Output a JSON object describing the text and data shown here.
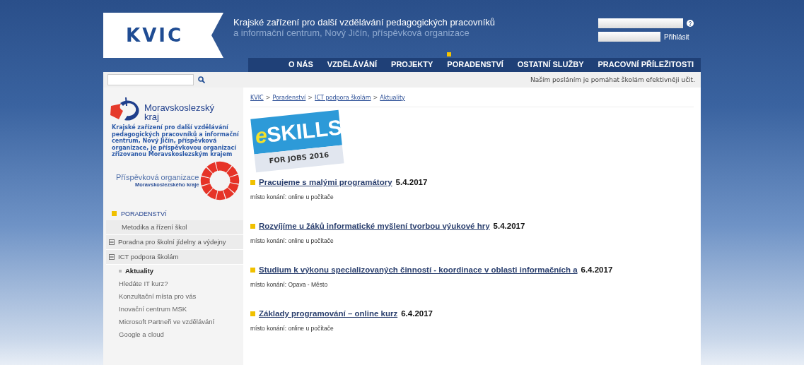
{
  "header": {
    "logo": "KVIC",
    "title_line1": "Krajské zařízení pro další vzdělávání pedagogických pracovníků",
    "title_line2": "a informační centrum, Nový Jičín, příspěvková organizace",
    "login_button": "Přihlásit"
  },
  "nav": [
    {
      "label": "O NÁS",
      "selected": false
    },
    {
      "label": "VZDĚLÁVÁNÍ",
      "selected": false
    },
    {
      "label": "PROJEKTY",
      "selected": false
    },
    {
      "label": "PORADENSTVÍ",
      "selected": true
    },
    {
      "label": "OSTATNÍ SLUŽBY",
      "selected": false
    },
    {
      "label": "PRACOVNÍ PŘÍLEŽITOSTI",
      "selected": false
    }
  ],
  "slogan": "Naším posláním je pomáhat školám efektivněji učit.",
  "sidebar": {
    "region_name_1": "Moravskoslezský",
    "region_name_2": "kraj",
    "description": "Krajské zařízení pro další vzdělávání pedagogických pracovníků a informační centrum, Nový Jičín, příspěvková organizace, je příspěvkovou organizací zřizovanou Moravskoslezským krajem",
    "badge_title": "Příspěvková organizace",
    "badge_subtitle": "Moravskoslezského kraje",
    "menu_title": "PORADENSTVÍ",
    "menu": [
      {
        "label": "Metodika a řízení škol",
        "kind": "plain"
      },
      {
        "label": "Poradna pro školní jídelny a výdejny",
        "kind": "expandable"
      },
      {
        "label": "ICT podpora školám",
        "kind": "expandable",
        "children": [
          {
            "label": "Aktuality",
            "selected": true
          },
          {
            "label": "Hledáte IT kurz?",
            "selected": false
          },
          {
            "label": "Konzultační místa pro vás",
            "selected": false
          },
          {
            "label": "Inovační centrum MSK",
            "selected": false
          },
          {
            "label": "Microsoft Partneři ve vzdělávání",
            "selected": false
          },
          {
            "label": "Google a cloud",
            "selected": false
          }
        ]
      }
    ]
  },
  "breadcrumb_separator": ">",
  "breadcrumb": [
    "KVIC",
    "Poradenství",
    "ICT podpora školám",
    "Aktuality"
  ],
  "banner": {
    "big": "SKILLS",
    "e": "e",
    "sub": "FOR JOBS 2016"
  },
  "events": [
    {
      "title": "Pracujeme s malými programátory",
      "date": "5.4.2017",
      "place_label": "místo konání:",
      "place": "online u počítače"
    },
    {
      "title": "Rozvíjíme u žáků informatické myšlení tvorbou výukové hry",
      "date": "5.4.2017",
      "place_label": "místo konání:",
      "place": "online u počítače"
    },
    {
      "title": "Studium k výkonu specializovaných činností - koordinace v oblasti informačních a",
      "date": "6.4.2017",
      "place_label": "místo konání:",
      "place": "Opava - Město"
    },
    {
      "title": "Základy programování – online kurz",
      "date": "6.4.2017",
      "place_label": "místo konání:",
      "place": "online u počítače"
    }
  ]
}
